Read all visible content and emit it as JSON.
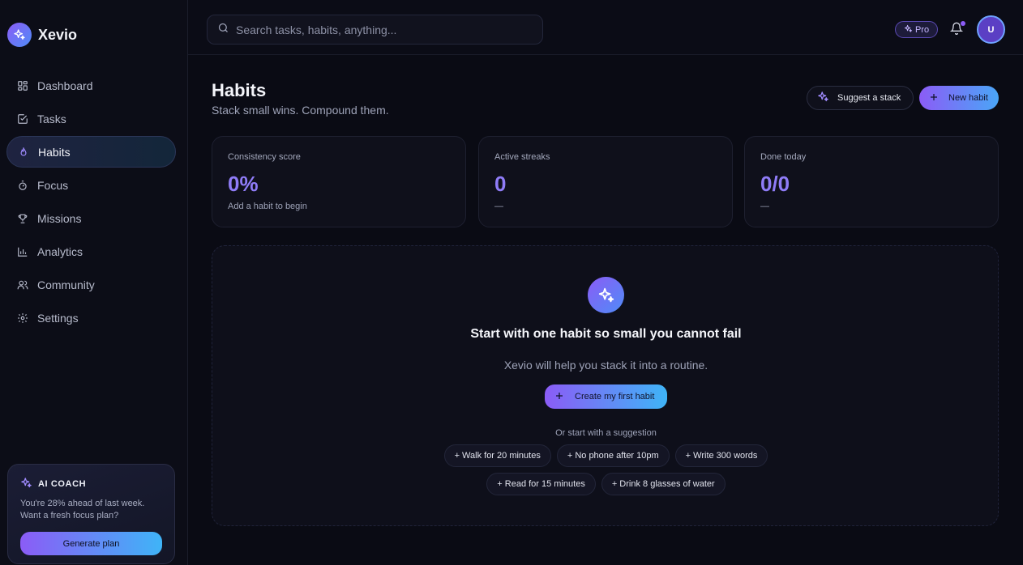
{
  "brand": {
    "name": "Xevio"
  },
  "sidebar": {
    "items": [
      {
        "label": "Dashboard",
        "icon": "grid-icon"
      },
      {
        "label": "Tasks",
        "icon": "checkbox-icon"
      },
      {
        "label": "Habits",
        "icon": "flame-icon",
        "active": true
      },
      {
        "label": "Focus",
        "icon": "timer-icon"
      },
      {
        "label": "Missions",
        "icon": "trophy-icon"
      },
      {
        "label": "Analytics",
        "icon": "bar-chart-icon"
      },
      {
        "label": "Community",
        "icon": "users-icon"
      },
      {
        "label": "Settings",
        "icon": "gear-icon"
      }
    ],
    "coach": {
      "title": "AI COACH",
      "line1": "You're 28% ahead of last week.",
      "line2": "Want a fresh focus plan?",
      "button": "Generate plan"
    }
  },
  "topbar": {
    "search_placeholder": "Search tasks, habits, anything...",
    "pro_label": "Pro",
    "avatar_initial": "U"
  },
  "page": {
    "title": "Habits",
    "subtitle": "Stack small wins. Compound them.",
    "suggest_button": "Suggest a stack",
    "new_button": "New habit"
  },
  "stats": [
    {
      "label": "Consistency score",
      "value": "0%",
      "note": "Add a habit to begin"
    },
    {
      "label": "Active streaks",
      "value": "0",
      "note": "—"
    },
    {
      "label": "Done today",
      "value": "0/0",
      "note": "—"
    }
  ],
  "empty": {
    "title": "Start with one habit so small you cannot fail",
    "subtitle": "Xevio will help you stack it into a routine.",
    "create_button": "Create my first habit",
    "or_label": "Or start with a suggestion",
    "suggestions": [
      "+ Walk for 20 minutes",
      "+ No phone after 10pm",
      "+ Write 300 words",
      "+ Read for 15 minutes",
      "+ Drink 8 glasses of water"
    ]
  },
  "colors": {
    "accent_purple": "#8b5cf6",
    "accent_blue": "#4f8cf7",
    "stat_value": "#8f7cf7",
    "background": "#0a0b14"
  }
}
